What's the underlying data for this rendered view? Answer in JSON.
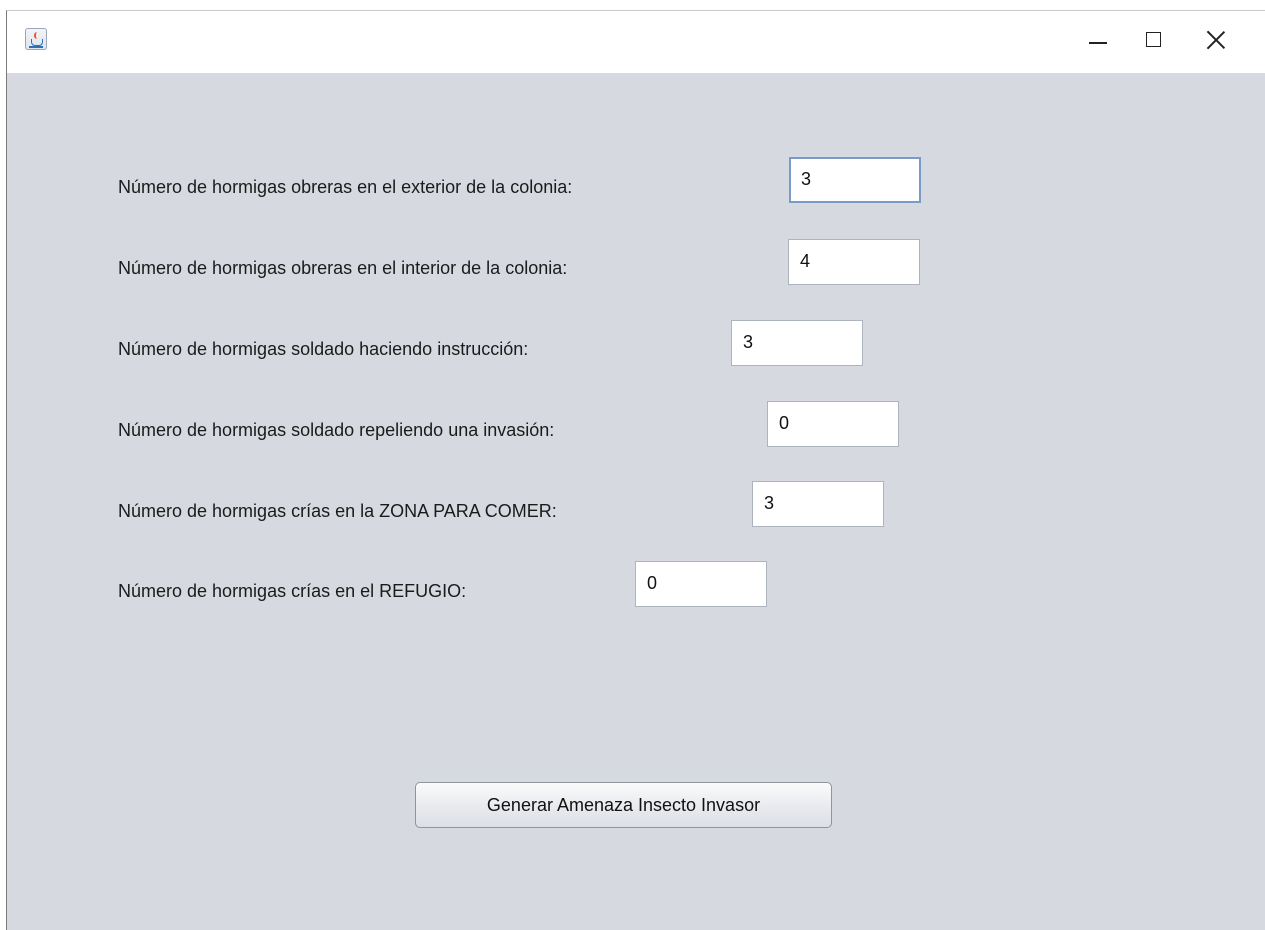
{
  "window": {
    "title": "",
    "controls": {
      "minimize_icon": "minimize-icon",
      "maximize_icon": "maximize-icon",
      "close_icon": "close-icon"
    }
  },
  "form": {
    "rows": [
      {
        "label": "Número de hormigas obreras en el exterior de la colonia:",
        "value": "3"
      },
      {
        "label": "Número de hormigas obreras en el interior de la colonia:",
        "value": "4"
      },
      {
        "label": "Número de hormigas soldado haciendo instrucción:",
        "value": "3"
      },
      {
        "label": "Número de hormigas soldado repeliendo una invasión:",
        "value": "0"
      },
      {
        "label": "Número de hormigas crías en la ZONA PARA COMER:",
        "value": "3"
      },
      {
        "label": "Número de hormigas crías en el REFUGIO:",
        "value": "0"
      }
    ]
  },
  "actions": {
    "generate_label": "Generar Amenaza Insecto Invasor"
  }
}
